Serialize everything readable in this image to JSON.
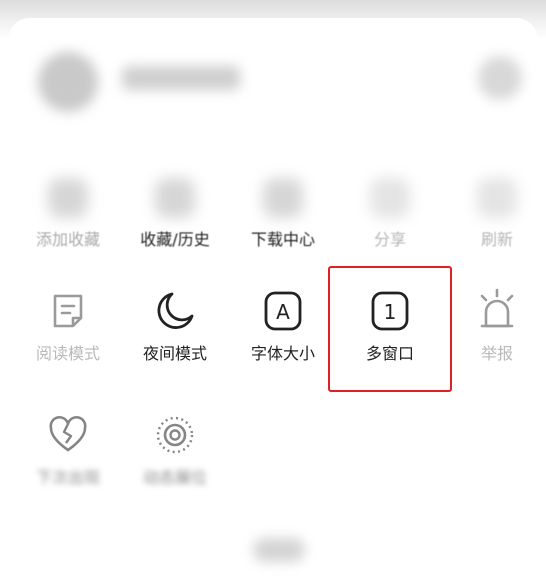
{
  "menu": {
    "row1": [
      {
        "label": "添加收藏",
        "icon": "add-favorite-icon"
      },
      {
        "label": "收藏/历史",
        "icon": "bookmarks-history-icon"
      },
      {
        "label": "下载中心",
        "icon": "download-center-icon"
      },
      {
        "label": "分享",
        "icon": "share-icon"
      },
      {
        "label": "刷新",
        "icon": "refresh-icon"
      }
    ],
    "row2": [
      {
        "label": "阅读模式",
        "icon": "reading-mode-icon"
      },
      {
        "label": "夜间模式",
        "icon": "moon-icon"
      },
      {
        "label": "字体大小",
        "icon": "font-size-icon",
        "glyph": "A"
      },
      {
        "label": "多窗口",
        "icon": "multi-window-icon",
        "glyph": "1"
      },
      {
        "label": "举报",
        "icon": "report-bell-icon"
      }
    ],
    "row3": [
      {
        "label": "下次出现",
        "icon": "broken-heart-icon"
      },
      {
        "label": "动态展位",
        "icon": "dynamic-ring-icon"
      }
    ]
  },
  "colors": {
    "highlight_border": "#e02020",
    "text_dark": "#222222",
    "text_faded": "#b9b9b9"
  }
}
